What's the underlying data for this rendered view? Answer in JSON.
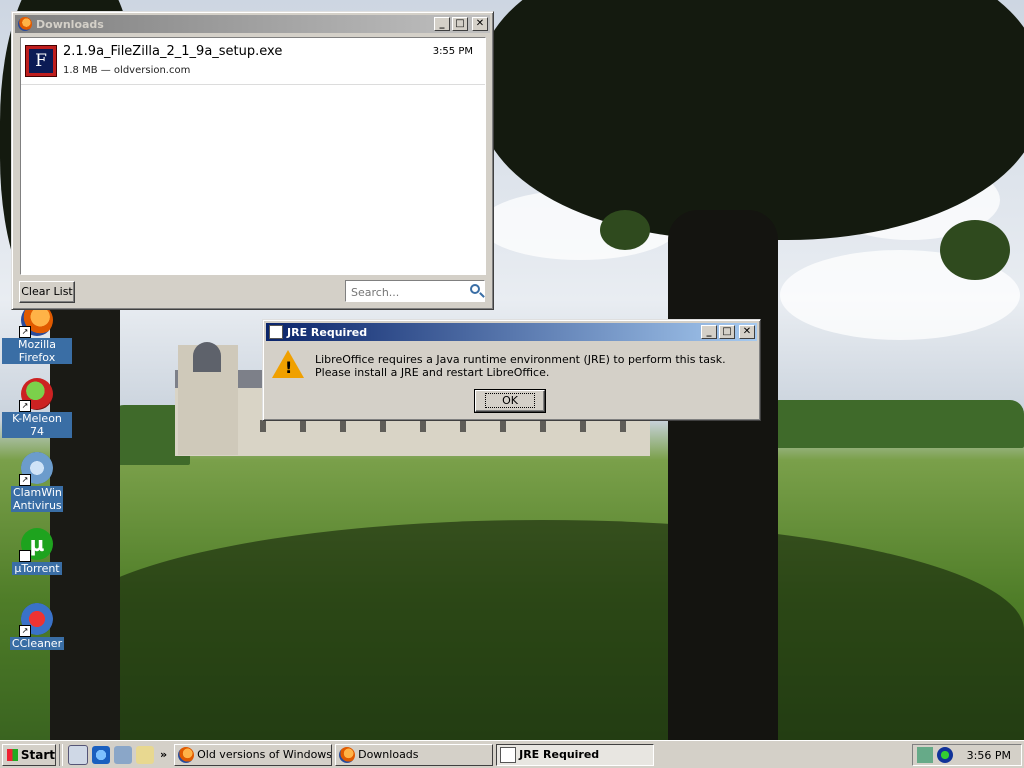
{
  "desktop": {
    "icons": [
      {
        "label": "Mozilla Firefox",
        "icon": "firefox-icon"
      },
      {
        "label": "K-Meleon 74",
        "icon": "k-meleon-icon"
      },
      {
        "label": "ClamWin Antivirus",
        "icon": "clamwin-icon"
      },
      {
        "label": "µTorrent",
        "icon": "utorrent-icon"
      },
      {
        "label": "CCleaner",
        "icon": "ccleaner-icon"
      }
    ]
  },
  "downloads_window": {
    "title": "Downloads",
    "item": {
      "filename": "2.1.9a_FileZilla_2_1_9a_setup.exe",
      "meta": "1.8 MB — oldversion.com",
      "time": "3:55 PM",
      "icon": "filezilla-icon"
    },
    "clear_list_label": "Clear List",
    "search_placeholder": "Search..."
  },
  "jre_dialog": {
    "title": "JRE Required",
    "message": "LibreOffice requires a Java runtime environment (JRE) to perform this task. Please install a JRE and restart LibreOffice.",
    "ok_label": "OK"
  },
  "taskbar": {
    "start_label": "Start",
    "more_label": "»",
    "tasks": [
      {
        "label": "Old versions of Windows,..."
      },
      {
        "label": "Downloads"
      },
      {
        "label": "JRE Required"
      }
    ],
    "clock": "3:56 PM"
  },
  "colors": {
    "title_active": "#0a246a",
    "title_inactive": "#808080",
    "desktop_label_bg": "#3a6ea5",
    "warning": "#f0a000"
  }
}
